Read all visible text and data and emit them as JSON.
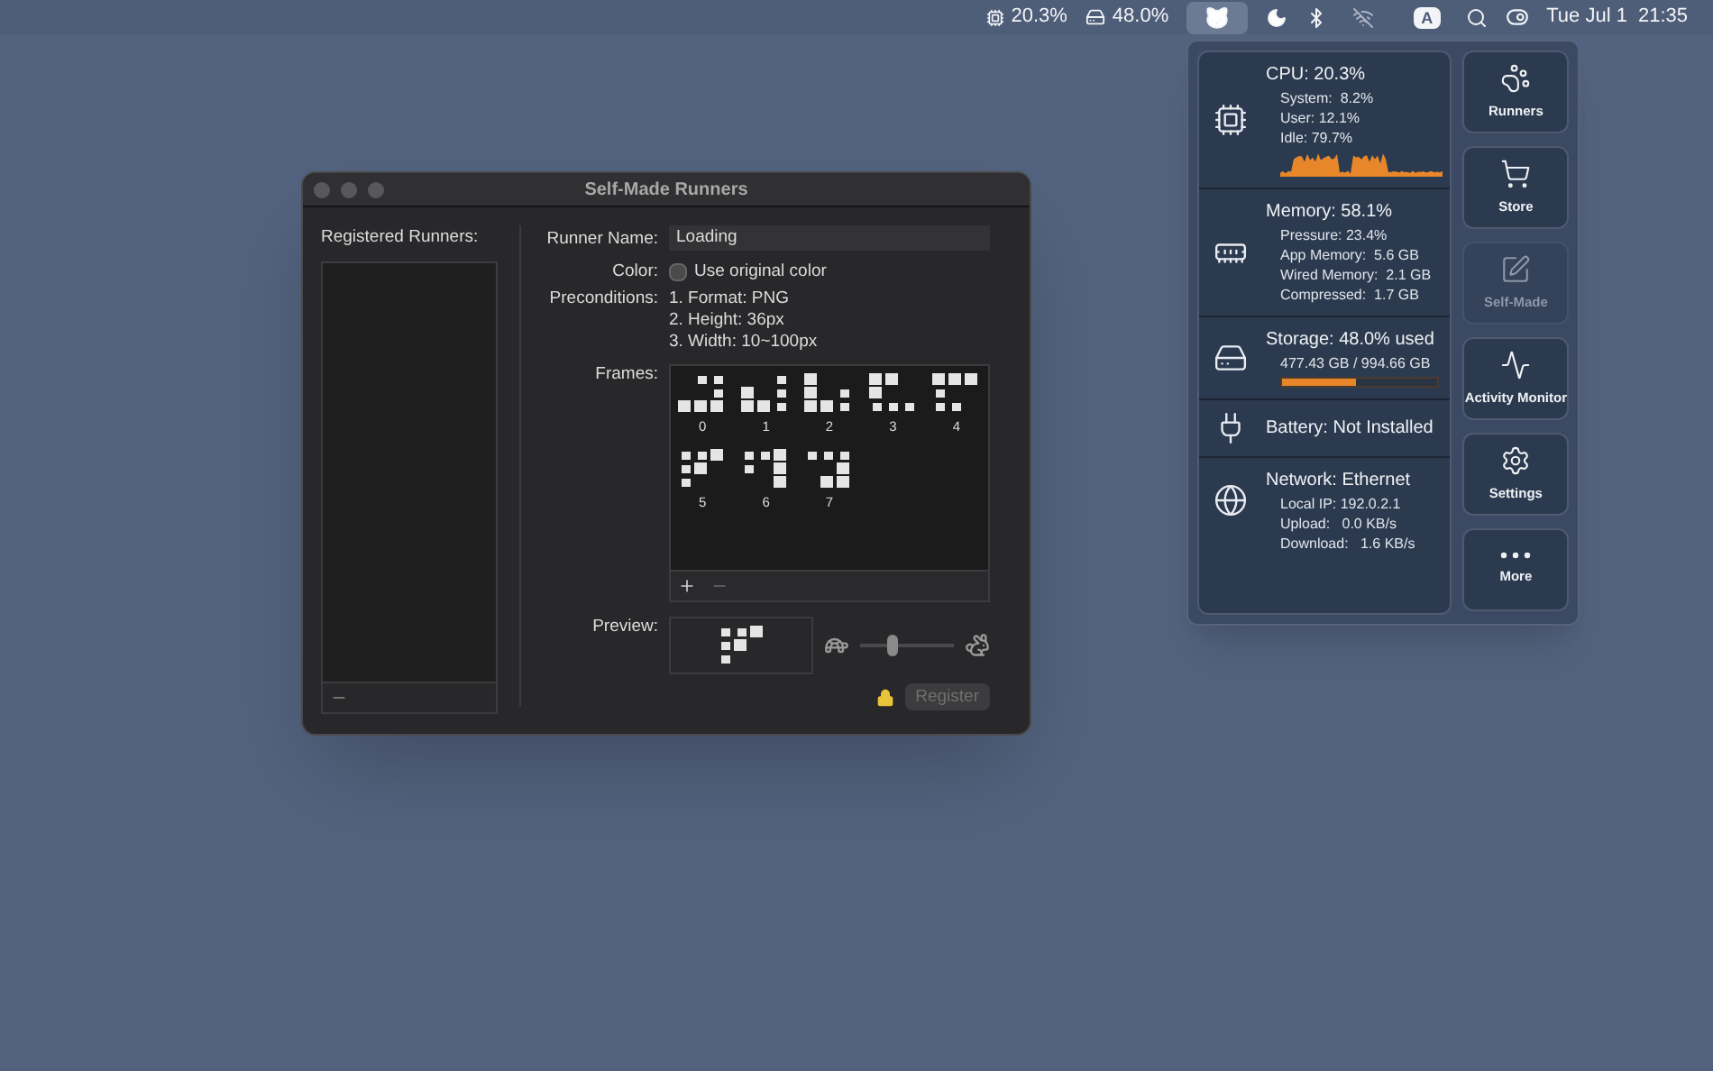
{
  "menu_bar": {
    "cpu": "20.3%",
    "storage": "48.0%",
    "runner_active": true,
    "input_source": "A",
    "date": "Tue Jul 1",
    "time": "21:35"
  },
  "panel": {
    "sections": [
      {
        "kind": "cpu",
        "title": "CPU: 20.3%",
        "lines": [
          "System:  8.2%",
          "User: 12.1%",
          "Idle: 79.7%"
        ]
      },
      {
        "kind": "memory",
        "title": "Memory: 58.1%",
        "lines": [
          "Pressure: 23.4%",
          "App Memory:  5.6 GB",
          "Wired Memory:  2.1 GB",
          "Compressed:  1.7 GB"
        ]
      },
      {
        "kind": "storage",
        "title": "Storage: 48.0% used",
        "lines": [
          "477.43 GB / 994.66 GB"
        ],
        "level": 0.48
      },
      {
        "kind": "battery",
        "title": "Battery: Not Installed"
      },
      {
        "kind": "network",
        "title": "Network: Ethernet",
        "lines": [
          "Local IP: 192.0.2.1",
          "Upload:   0.0 KB/s",
          "Download:   1.6 KB/s"
        ]
      }
    ],
    "buttons": [
      {
        "kind": "paw",
        "label": "Runners",
        "disabled": false
      },
      {
        "kind": "cart",
        "label": "Store",
        "disabled": false
      },
      {
        "kind": "edit",
        "label": "Self-Made",
        "disabled": true
      },
      {
        "kind": "pulse",
        "label": "Activity Monitor",
        "disabled": false
      },
      {
        "kind": "gear",
        "label": "Settings",
        "disabled": false
      },
      {
        "kind": "more",
        "label": "More",
        "disabled": false
      }
    ]
  },
  "window": {
    "title": "Self-Made Runners",
    "registered_label": "Registered Runners:",
    "runner_name": {
      "label": "Runner Name:",
      "value": "Loading"
    },
    "color": {
      "label": "Color:",
      "checkbox_label": "Use original color",
      "checked": false
    },
    "preconditions": {
      "label": "Preconditions:",
      "items": [
        "1. Format: PNG",
        "2. Height: 36px",
        "3. Width: 10~100px"
      ]
    },
    "frames": {
      "label": "Frames:",
      "items": [
        "0",
        "1",
        "2",
        "3",
        "4",
        "5",
        "6",
        "7"
      ]
    },
    "preview": {
      "label": "Preview:"
    },
    "speed": {
      "level": 0.35
    },
    "register": {
      "label": "Register",
      "disabled": true
    }
  }
}
